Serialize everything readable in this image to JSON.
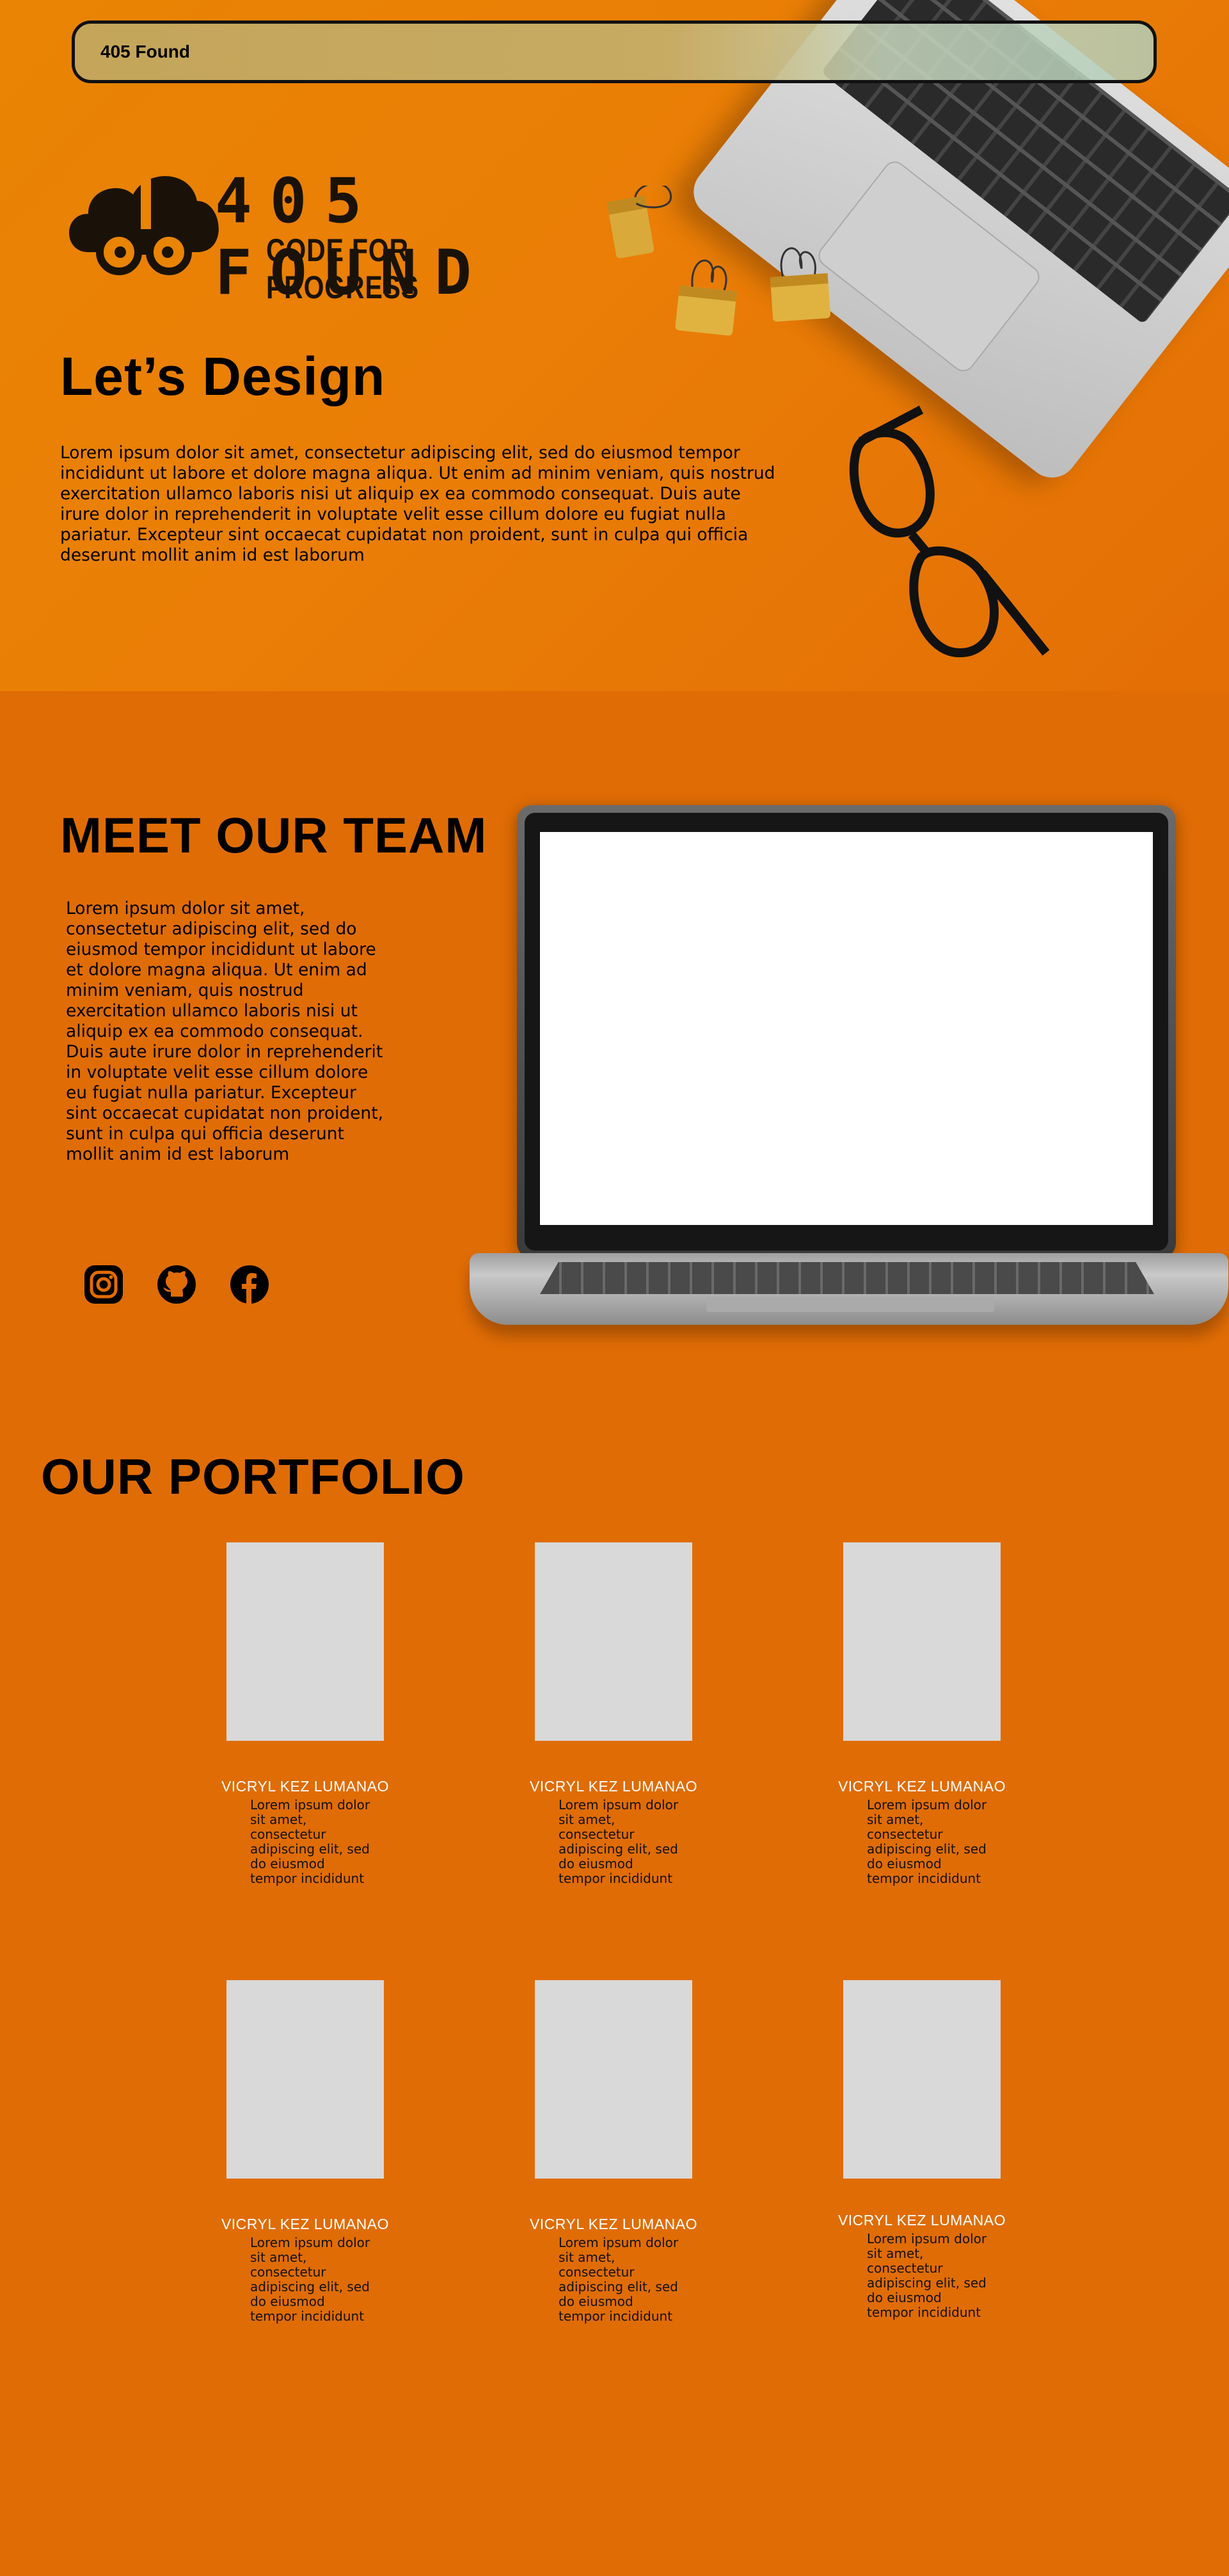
{
  "navbar": {
    "brand": "405 Found"
  },
  "logo": {
    "title": "405 FOUND",
    "tagline": "CODE FOR PROGRESS"
  },
  "hero": {
    "heading": "Let’s Design",
    "intro": "Lorem ipsum dolor sit amet, consectetur adipiscing elit, sed do eiusmod tempor incididunt ut labore et dolore magna aliqua. Ut enim ad minim veniam, quis nostrud exercitation ullamco laboris nisi ut aliquip ex ea commodo consequat. Duis aute irure dolor in reprehenderit in voluptate velit esse cillum dolore eu fugiat nulla pariatur. Excepteur sint occaecat cupidatat non proident, sunt in culpa qui officia deserunt mollit anim id est laborum"
  },
  "team": {
    "heading": "MEET OUR TEAM",
    "text": "Lorem ipsum dolor sit amet, consectetur adipiscing elit, sed do eiusmod tempor incididunt ut labore et dolore magna aliqua. Ut enim ad minim veniam, quis nostrud exercitation ullamco laboris nisi ut aliquip ex ea commodo consequat. Duis aute irure dolor in reprehenderit in voluptate velit esse cillum dolore eu fugiat nulla pariatur. Excepteur sint occaecat cupidatat non proident, sunt in culpa qui officia deserunt mollit anim id est laborum",
    "socials": [
      "instagram-icon",
      "github-icon",
      "facebook-icon"
    ]
  },
  "portfolio": {
    "heading": "OUR PORTFOLIO",
    "items": [
      {
        "name": "VICRYL KEZ LUMANAO",
        "desc": "Lorem ipsum dolor sit amet, consectetur adipiscing elit, sed do eiusmod tempor incididunt"
      },
      {
        "name": "VICRYL KEZ LUMANAO",
        "desc": "Lorem ipsum dolor sit amet, consectetur adipiscing elit, sed do eiusmod tempor incididunt"
      },
      {
        "name": "VICRYL KEZ LUMANAO",
        "desc": "Lorem ipsum dolor sit amet, consectetur adipiscing elit, sed do eiusmod tempor incididunt"
      },
      {
        "name": "VICRYL KEZ LUMANAO",
        "desc": "Lorem ipsum dolor sit amet, consectetur adipiscing elit, sed do eiusmod tempor incididunt"
      },
      {
        "name": "VICRYL KEZ LUMANAO",
        "desc": "Lorem ipsum dolor sit amet, consectetur adipiscing elit, sed do eiusmod tempor incididunt"
      },
      {
        "name": "VICRYL KEZ LUMANAO",
        "desc": "Lorem ipsum dolor sit amet, consectetur adipiscing elit, sed do eiusmod tempor incididunt"
      }
    ]
  },
  "colors": {
    "background": "#e06c05",
    "hero": "#ea7e06",
    "thumb": "#d9d9d9",
    "nav": "#c4a55a"
  }
}
